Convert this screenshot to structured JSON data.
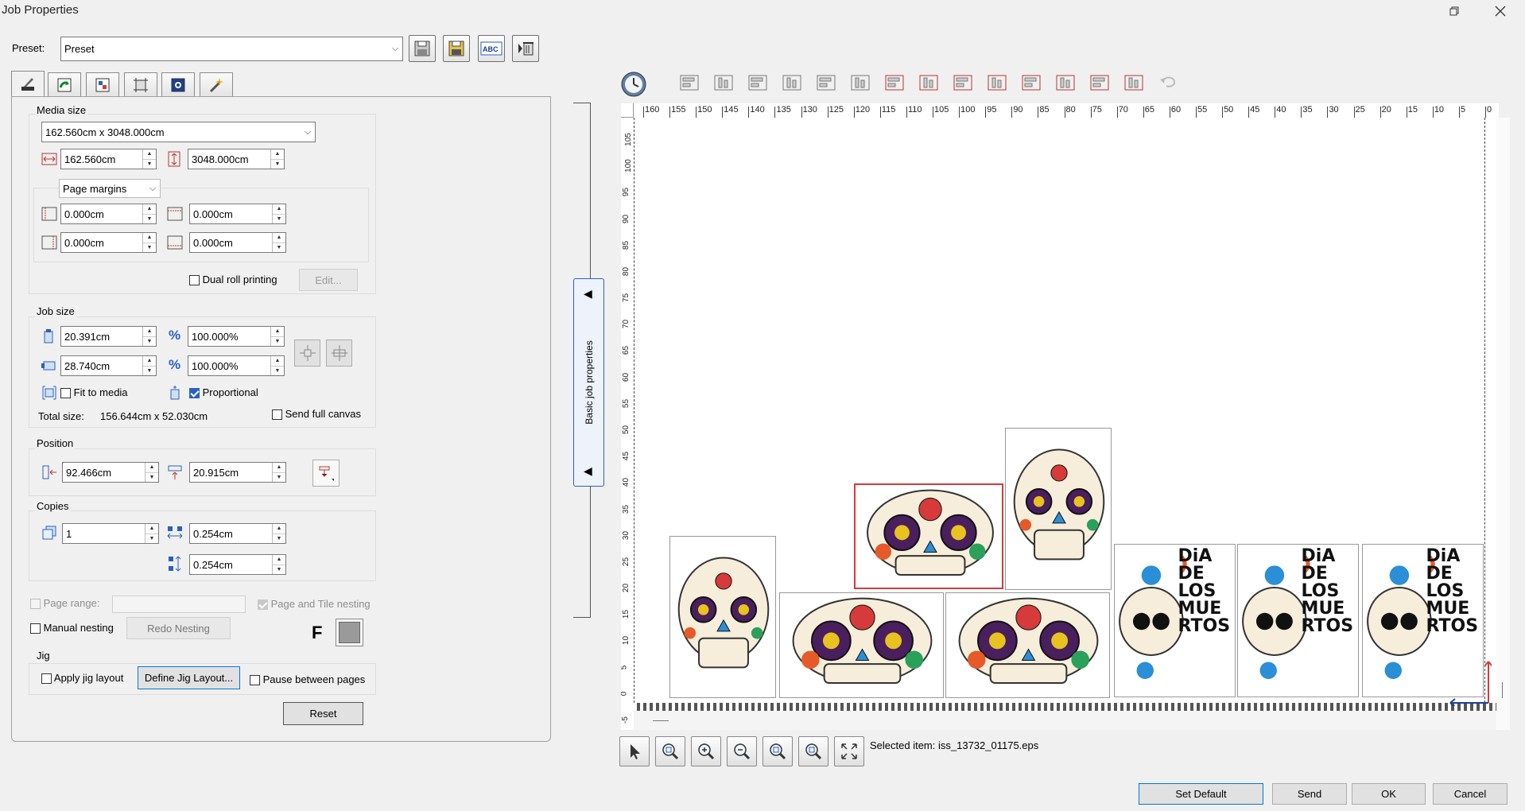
{
  "window": {
    "title": "Job Properties",
    "controls": [
      "maximize-icon",
      "close-icon"
    ]
  },
  "preset": {
    "label": "Preset:",
    "value": "Preset",
    "buttons": [
      "save-icon",
      "save-as-icon",
      "rename-icon",
      "delete-icon"
    ]
  },
  "tabs": [
    "layout-tab-icon",
    "transform-tab-icon",
    "color-tab-icon",
    "crop-tab-icon",
    "effects-tab-icon",
    "wizard-tab-icon"
  ],
  "media_size": {
    "title": "Media size",
    "value": "162.560cm x 3048.000cm",
    "width": "162.560cm",
    "height": "3048.000cm",
    "margins_label": "Page margins",
    "margin_left": "0.000cm",
    "margin_top": "0.000cm",
    "margin_right": "0.000cm",
    "margin_bottom": "0.000cm",
    "dual_roll_label": "Dual roll printing",
    "dual_roll_checked": false,
    "edit_label": "Edit..."
  },
  "job_size": {
    "title": "Job size",
    "width": "20.391cm",
    "width_pct": "100.000%",
    "height": "28.740cm",
    "height_pct": "100.000%",
    "pct_symbol": "%",
    "fit_to_media_label": "Fit to media",
    "fit_to_media_checked": false,
    "proportional_label": "Proportional",
    "proportional_checked": true,
    "total_size_label": "Total size:",
    "total_size_value": "156.644cm x 52.030cm",
    "send_full_canvas_label": "Send full canvas",
    "send_full_canvas_checked": false
  },
  "position": {
    "title": "Position",
    "x": "92.466cm",
    "y": "20.915cm"
  },
  "copies": {
    "title": "Copies",
    "count": "1",
    "h_spacing": "0.254cm",
    "v_spacing": "0.254cm"
  },
  "nesting": {
    "page_range_label": "Page range:",
    "page_range_value": "",
    "page_tile_nesting_label": "Page and Tile nesting",
    "manual_nesting_label": "Manual nesting",
    "redo_nesting_label": "Redo Nesting",
    "f_label": "F"
  },
  "jig": {
    "title": "Jig",
    "apply_label": "Apply jig layout",
    "define_label": "Define Jig Layout...",
    "pause_label": "Pause between pages"
  },
  "reset_label": "Reset",
  "side_panel": {
    "label": "Basic job properties"
  },
  "toolbar_icons": [
    "clock-icon",
    "align-left-icon",
    "align-right-icon",
    "align-top-icon",
    "align-bottom-icon",
    "center-horizontal-icon",
    "center-vertical-icon",
    "align-left-page-icon",
    "align-right-page-icon",
    "align-top-page-icon",
    "align-bottom-page-icon",
    "center-page-icon",
    "distribute-horizontal-icon",
    "distribute-center-icon",
    "distribute-vertical-icon",
    "undo-icon"
  ],
  "ruler": {
    "h_labels": [
      "160",
      "155",
      "150",
      "145",
      "140",
      "135",
      "130",
      "125",
      "120",
      "115",
      "110",
      "105",
      "100",
      "95",
      "90",
      "85",
      "80",
      "75",
      "70",
      "65",
      "60",
      "55",
      "50",
      "45",
      "40",
      "35",
      "30",
      "25",
      "20",
      "15",
      "10",
      "5",
      "0"
    ],
    "v_labels": [
      "105",
      "100",
      "95",
      "90",
      "85",
      "80",
      "75",
      "70",
      "65",
      "60",
      "55",
      "50",
      "45",
      "40",
      "35",
      "30",
      "25",
      "20",
      "15",
      "10",
      "5",
      "0",
      "-5"
    ]
  },
  "canvas_items": [
    {
      "name": "skull-tall-1",
      "artwork": "sugar skull",
      "selected": false
    },
    {
      "name": "skull-wide-1",
      "artwork": "sugar skull",
      "selected": false
    },
    {
      "name": "skull-selected",
      "artwork": "sugar skull",
      "selected": true
    },
    {
      "name": "skull-wide-2",
      "artwork": "sugar skull",
      "selected": false
    },
    {
      "name": "skull-tall-2",
      "artwork": "sugar skull",
      "selected": false
    },
    {
      "name": "dia-1",
      "text": "DiA DE LOS MUERTOS",
      "selected": false
    },
    {
      "name": "dia-2",
      "text": "DiA DE LOS MUERTOS",
      "selected": false
    },
    {
      "name": "dia-3",
      "text": "DiA DE LOS MUERTOS",
      "selected": false
    }
  ],
  "view_tools": [
    "select-arrow-icon",
    "zoom-area-icon",
    "zoom-in-icon",
    "zoom-out-icon",
    "zoom-selection-icon",
    "zoom-page-icon",
    "fit-screen-icon"
  ],
  "selected_item": "Selected item: iss_13732_01175.eps",
  "footer": {
    "set_default": "Set Default",
    "send": "Send",
    "ok": "OK",
    "cancel": "Cancel"
  },
  "colors": {
    "accent": "#0078d7",
    "selection": "#d63a3a",
    "check_blue": "#2a5fc4"
  }
}
